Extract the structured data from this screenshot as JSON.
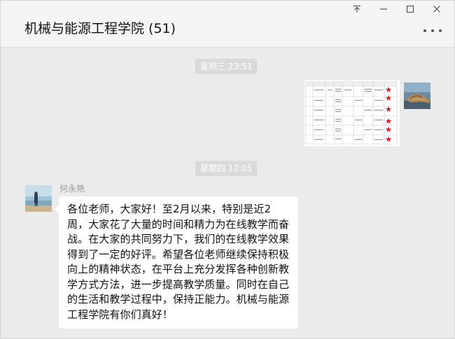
{
  "header": {
    "title": "机械与能源工程学院 (51)"
  },
  "window_controls": {
    "pin_icon": "pin-icon",
    "minimize_icon": "minimize-icon",
    "maximize_icon": "maximize-icon",
    "close_icon": "close-icon"
  },
  "messages": {
    "timestamp_1": "星期三 23:51",
    "timestamp_2": "星期四 12:05",
    "incoming": {
      "sender": "何永艳",
      "text": "各位老师，大家好！至2月以来，特别是近2周，大家花了大量的时间和精力为在线教学而奋战。在大家的共同努力下，我们的在线教学效果得到了一定的好评。希望各位老师继续保持积极向上的精神状态，在平台上充分发挥各种创新教学方式方法，进一步提高教学质量。同时在自己的生活和教学过程中，保持正能力。机械与能源工程学院有你们真好！"
    }
  },
  "colors": {
    "background": "#ebebeb",
    "titlebar": "#f5f5f5",
    "bubble": "#ffffff",
    "timestamp_bg": "#dadada",
    "star_red": "#e02020"
  }
}
